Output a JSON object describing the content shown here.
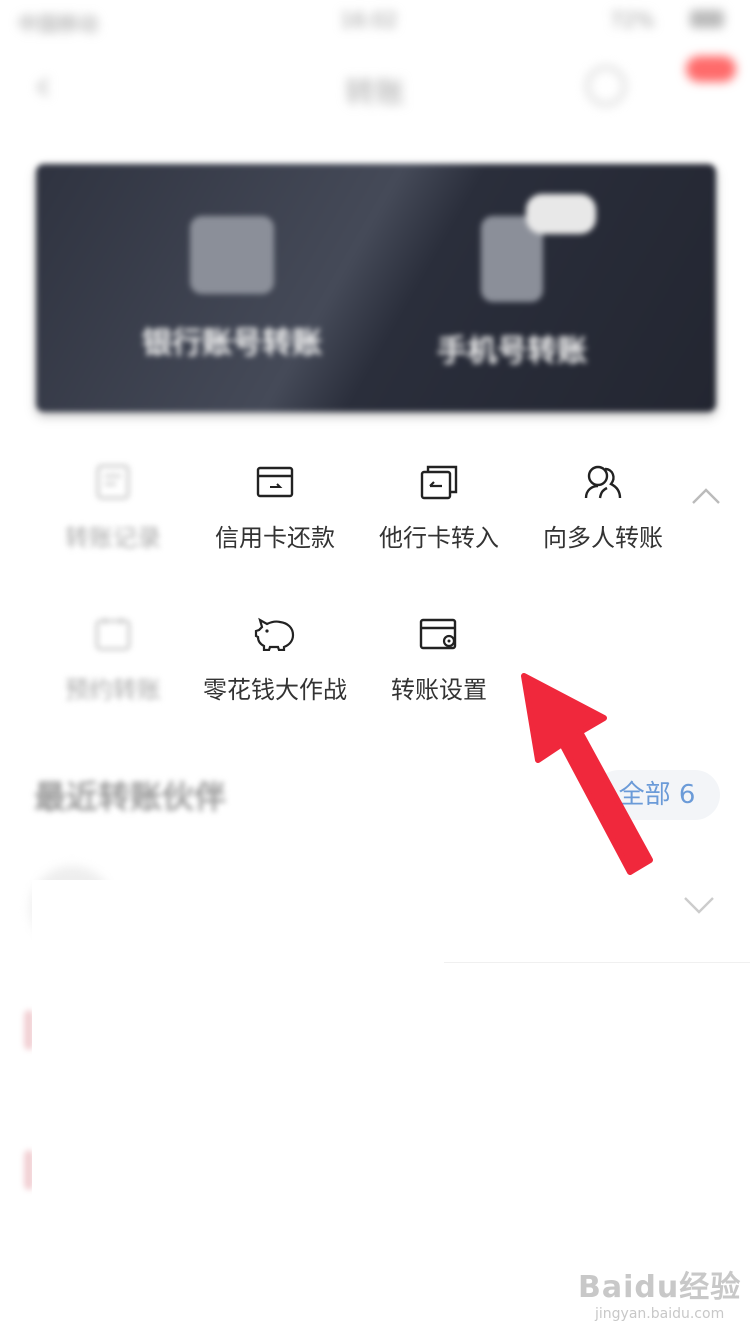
{
  "status_bar": {
    "carrier": "中国移动",
    "time": "16:02",
    "battery": "72%"
  },
  "nav": {
    "title": "转账"
  },
  "banner": {
    "left_label": "银行账号转账",
    "right_label": "手机号转账"
  },
  "grid": {
    "row1": [
      {
        "label": "转账记录",
        "icon": "record-icon"
      },
      {
        "label": "信用卡还款",
        "icon": "credit-card-icon"
      },
      {
        "label": "他行卡转入",
        "icon": "transfer-in-icon"
      },
      {
        "label": "向多人转账",
        "icon": "multi-person-icon"
      }
    ],
    "row2": [
      {
        "label": "预约转账",
        "icon": "calendar-icon"
      },
      {
        "label": "零花钱大作战",
        "icon": "piggy-bank-icon"
      },
      {
        "label": "转账设置",
        "icon": "card-settings-icon"
      }
    ]
  },
  "partners": {
    "title": "最近转账伙伴",
    "all_button": "全部 6"
  },
  "watermark": {
    "logo": "Baidu经验",
    "url": "jingyan.baidu.com"
  },
  "colors": {
    "arrow": "#f0283c",
    "accent_blue": "#6b9bd8",
    "banner_bg": "#2f3340"
  }
}
